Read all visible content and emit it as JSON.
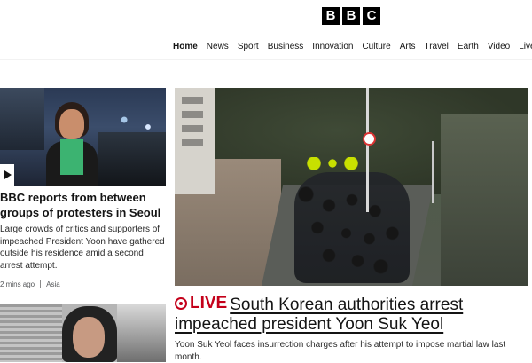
{
  "brand": {
    "letters": [
      "B",
      "B",
      "C"
    ]
  },
  "nav": {
    "items": [
      "Home",
      "News",
      "Sport",
      "Business",
      "Innovation",
      "Culture",
      "Arts",
      "Travel",
      "Earth",
      "Video",
      "Live"
    ],
    "active": "Home"
  },
  "left_card": {
    "title": "BBC reports from between groups of protesters in Seoul",
    "summary": "Large crowds of critics and supporters of impeached President Yoon have gathered outside his residence amid a second arrest attempt.",
    "time": "2 mins ago",
    "section": "Asia",
    "icon": "play-icon"
  },
  "main_story": {
    "live_label": "LIVE",
    "headline": "South Korean authorities arrest impeached president Yoon Suk Yeol",
    "summary": "Yoon Suk Yeol faces insurrection charges after his attempt to impose martial law last month."
  },
  "colors": {
    "live_red": "#c4001a",
    "text": "#141414",
    "brand_bg": "#000000"
  }
}
